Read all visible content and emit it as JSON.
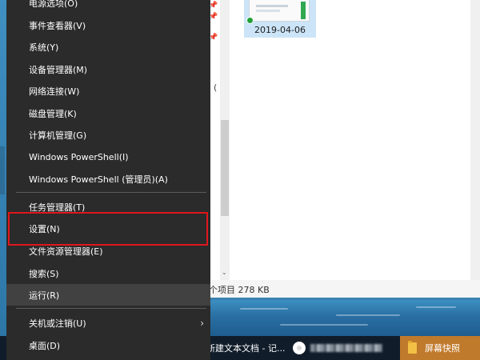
{
  "menu": {
    "items": [
      {
        "label": "电源选项(O)"
      },
      {
        "label": "事件查看器(V)"
      },
      {
        "label": "系统(Y)"
      },
      {
        "label": "设备管理器(M)"
      },
      {
        "label": "网络连接(W)"
      },
      {
        "label": "磁盘管理(K)"
      },
      {
        "label": "计算机管理(G)"
      },
      {
        "label": "Windows PowerShell(I)"
      },
      {
        "label": "Windows PowerShell (管理员)(A)"
      },
      {
        "label": "任务管理器(T)"
      },
      {
        "label": "设置(N)",
        "highlighted": true
      },
      {
        "label": "文件资源管理器(E)"
      },
      {
        "label": "搜索(S)"
      },
      {
        "label": "运行(R)",
        "hovered": true
      },
      {
        "label": "关机或注销(U)",
        "submenu_arrow": "›"
      },
      {
        "label": "桌面(D)"
      }
    ],
    "highlight_color": "#e0161c"
  },
  "explorer": {
    "file_tile": {
      "date_label": "2019-04-06"
    },
    "partial_char": "(",
    "status_text": "个项目  278 KB"
  },
  "taskbar": {
    "notepad_label": "新建文本文档 - 记...",
    "screenshot_label": "屏幕快照"
  }
}
